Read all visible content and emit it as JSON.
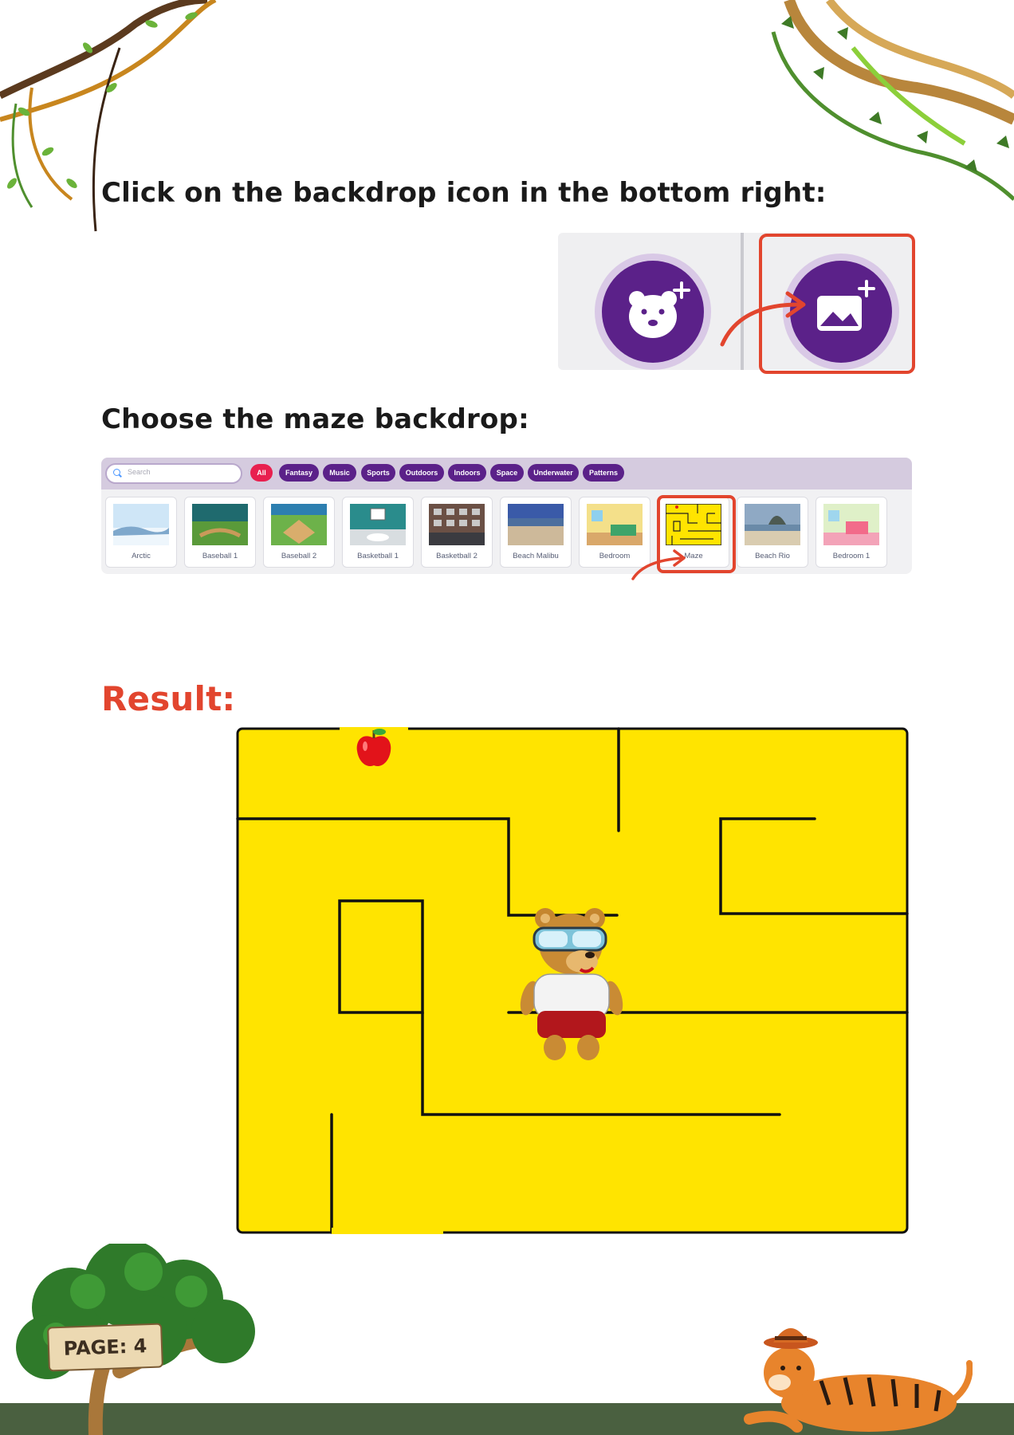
{
  "instructions": {
    "step1": "Click on the backdrop icon in the bottom right:",
    "step2": "Choose the maze backdrop:",
    "result": "Result:"
  },
  "buttons": {
    "sprite_button_icon": "bear-face-icon",
    "backdrop_button_icon": "image-plus-icon",
    "accent_color": "#5b2189",
    "highlight_color": "#e2452e"
  },
  "backdrop_library": {
    "search_placeholder": "Search",
    "filters": [
      {
        "label": "All",
        "active": true
      },
      {
        "label": "Fantasy"
      },
      {
        "label": "Music"
      },
      {
        "label": "Sports"
      },
      {
        "label": "Outdoors"
      },
      {
        "label": "Indoors"
      },
      {
        "label": "Space"
      },
      {
        "label": "Underwater"
      },
      {
        "label": "Patterns"
      }
    ],
    "items": [
      {
        "label": "Arctic"
      },
      {
        "label": "Baseball 1"
      },
      {
        "label": "Baseball 2"
      },
      {
        "label": "Basketball 1"
      },
      {
        "label": "Basketball 2"
      },
      {
        "label": "Beach Malibu"
      },
      {
        "label": "Bedroom"
      },
      {
        "label": "Maze",
        "highlighted": true
      },
      {
        "label": "Beach Rio"
      },
      {
        "label": "Bedroom 1"
      }
    ]
  },
  "stage": {
    "backdrop": "Maze",
    "background_color": "#ffe400",
    "sprites": [
      "apple-sprite",
      "bear-sprite"
    ]
  },
  "footer": {
    "page_label": "PAGE: 4"
  }
}
